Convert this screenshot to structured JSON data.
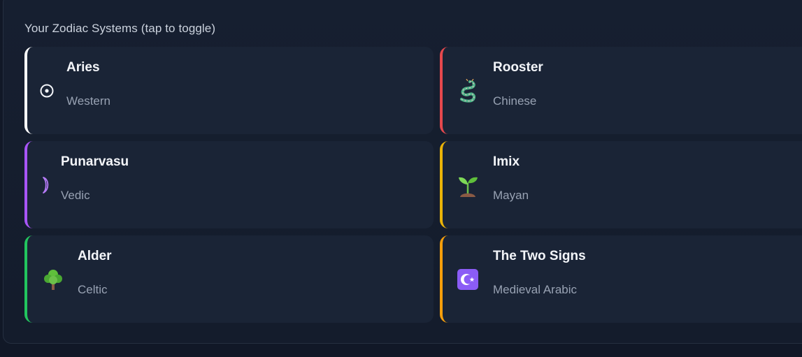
{
  "section": {
    "title": "Your Zodiac Systems (tap to toggle)"
  },
  "cards": [
    {
      "name": "Aries",
      "system": "Western",
      "icon": "sun-circle-icon",
      "glyph": "⊙",
      "accent": "#ffffff"
    },
    {
      "name": "Rooster",
      "system": "Chinese",
      "icon": "dragon-icon",
      "glyph": "🐉",
      "accent": "#e5484d"
    },
    {
      "name": "Punarvasu",
      "system": "Vedic",
      "icon": "crescent-moon-icon",
      "glyph": "☽",
      "accent": "#a855f7"
    },
    {
      "name": "Imix",
      "system": "Mayan",
      "icon": "seedling-icon",
      "glyph": "🌱",
      "accent": "#eab308"
    },
    {
      "name": "Alder",
      "system": "Celtic",
      "icon": "tree-icon",
      "glyph": "🌳",
      "accent": "#22c55e"
    },
    {
      "name": "The Two Signs",
      "system": "Medieval Arabic",
      "icon": "star-and-crescent-icon",
      "glyph": "☪",
      "accent": "#f59e0b"
    }
  ]
}
